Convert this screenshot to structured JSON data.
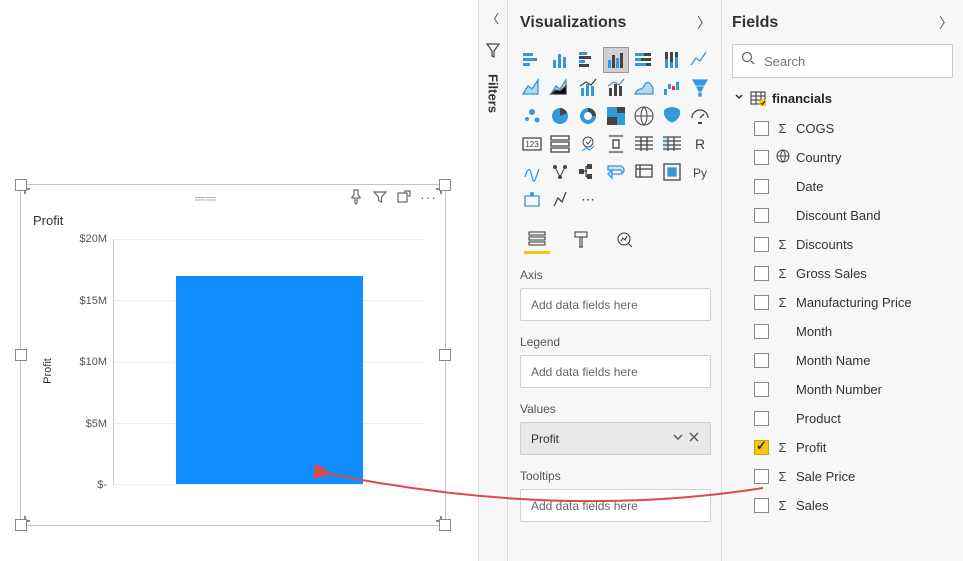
{
  "panes": {
    "filters_label": "Filters",
    "visualizations_title": "Visualizations",
    "fields_title": "Fields",
    "search_placeholder": "Search"
  },
  "viz_icons": [
    "stacked-bar",
    "stacked-column",
    "clustered-bar",
    "clustered-column",
    "100-bar",
    "100-column",
    "line",
    "area",
    "stacked-area",
    "line-col",
    "line-col2",
    "ribbon",
    "waterfall",
    "funnel",
    "scatter",
    "pie",
    "donut",
    "treemap",
    "map",
    "filled-map",
    "ai",
    "gauge",
    "card",
    "multirow",
    "kpi",
    "slicer",
    "table",
    "matrix",
    "r",
    "python",
    "keyinfluencer",
    "decomp",
    "qa",
    "paginated",
    "more",
    "powerapps",
    "custom",
    "ellipsis"
  ],
  "viz_selected_index": 3,
  "wells": {
    "axis_label": "Axis",
    "axis_placeholder": "Add data fields here",
    "legend_label": "Legend",
    "legend_placeholder": "Add data fields here",
    "values_label": "Values",
    "values_field": "Profit",
    "tooltips_label": "Tooltips",
    "tooltips_placeholder": "Add data fields here"
  },
  "table": {
    "name": "financials",
    "fields": [
      {
        "name": "COGS",
        "type": "sum",
        "checked": false
      },
      {
        "name": "Country",
        "type": "geo",
        "checked": false
      },
      {
        "name": "Date",
        "type": "none",
        "checked": false
      },
      {
        "name": "Discount Band",
        "type": "none",
        "checked": false
      },
      {
        "name": "Discounts",
        "type": "sum",
        "checked": false
      },
      {
        "name": "Gross Sales",
        "type": "sum",
        "checked": false
      },
      {
        "name": "Manufacturing Price",
        "type": "sum",
        "checked": false
      },
      {
        "name": "Month",
        "type": "none",
        "checked": false
      },
      {
        "name": "Month Name",
        "type": "none",
        "checked": false
      },
      {
        "name": "Month Number",
        "type": "none",
        "checked": false
      },
      {
        "name": "Product",
        "type": "none",
        "checked": false
      },
      {
        "name": "Profit",
        "type": "sum",
        "checked": true
      },
      {
        "name": "Sale Price",
        "type": "sum",
        "checked": false
      },
      {
        "name": "Sales",
        "type": "sum",
        "checked": false
      }
    ]
  },
  "chart_data": {
    "type": "bar",
    "title": "Profit",
    "ylabel": "Profit",
    "xlabel": "",
    "categories": [
      ""
    ],
    "values": [
      17000000
    ],
    "yticks": [
      0,
      5000000,
      10000000,
      15000000,
      20000000
    ],
    "ytick_labels": [
      "$-",
      "$5M",
      "$10M",
      "$15M",
      "$20M"
    ],
    "ylim": [
      0,
      20000000
    ],
    "bar_color": "#118dff"
  }
}
